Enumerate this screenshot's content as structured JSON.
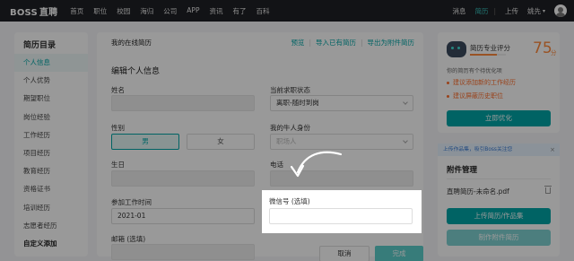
{
  "topbar": {
    "logo": "BOSS",
    "logo_suffix": "直聘",
    "nav": [
      "首页",
      "职位",
      "校园",
      "海归",
      "公司",
      "APP",
      "资讯",
      "有了",
      "百科"
    ],
    "right": {
      "messages": "消息",
      "resume": "简历",
      "upload": "上传",
      "user": "姚先"
    }
  },
  "sidebar": {
    "title": "简历目录",
    "items": [
      "个人信息",
      "个人优势",
      "期望职位",
      "岗位经验",
      "工作经历",
      "项目经历",
      "教育经历",
      "资格证书",
      "培训经历",
      "志愿者经历",
      "自定义添加"
    ],
    "active_index": 0
  },
  "main": {
    "header_title": "我的在线简历",
    "links": {
      "preview": "预览",
      "import": "导入已有简历",
      "export": "导出为附件简历"
    },
    "edit_title": "编辑个人信息",
    "labels": {
      "name": "姓名",
      "status": "当前求职状态",
      "gender": "性别",
      "identity": "我的牛人身份",
      "birthday": "生日",
      "phone": "电话",
      "work_start": "参加工作时间",
      "email": "邮箱 (选填)",
      "wechat": "微信号 (选填)"
    },
    "values": {
      "status": "离职-随时到岗",
      "identity_placeholder": "职场人",
      "work_start": "2021-01"
    },
    "gender_options": [
      "男",
      "女"
    ],
    "gender_selected": "男",
    "buttons": {
      "cancel": "取消",
      "done": "完成"
    }
  },
  "score_card": {
    "title": "简历专业评分",
    "score": "75",
    "unit": "分",
    "score_fraction": 0.75,
    "tip": "你的简历有个待优化项",
    "suggestions": [
      "建议添加新的工作经历",
      "建议屏蔽历史职位"
    ],
    "optimize_button": "立即优化"
  },
  "notice": {
    "text": "上传作品集，吸引Boss关注您",
    "close": "×"
  },
  "attachments": {
    "title": "附件管理",
    "file_name": "直聘简历-未命名.pdf",
    "upload_button": "上传简历/作品集",
    "make_button": "制作附件简历"
  },
  "colors": {
    "accent": "#00a6a7",
    "score": "#ff8a3d",
    "topbar": "#1f2025"
  }
}
